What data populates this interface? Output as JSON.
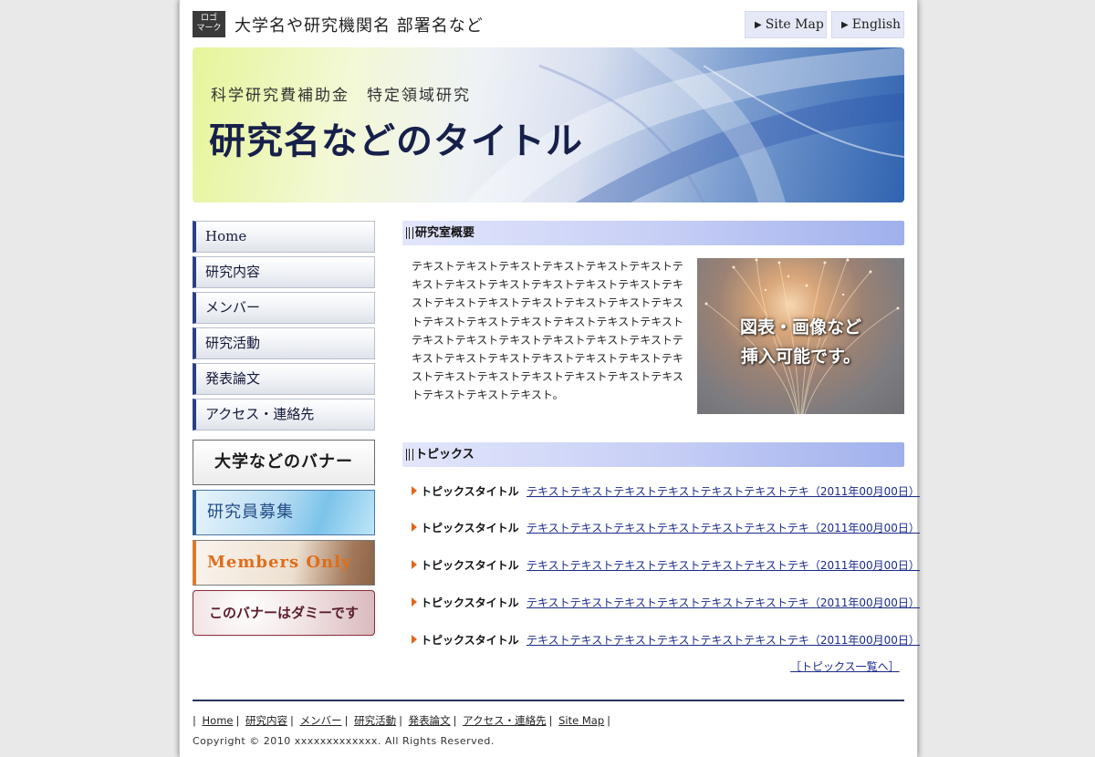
{
  "header": {
    "logo_line1": "ロゴ",
    "logo_line2": "マーク",
    "org_name": "大学名や研究機関名 部署名など",
    "sitemap_label": "Site Map",
    "english_label": "English"
  },
  "hero": {
    "subtitle": "科学研究費補助金　特定領域研究",
    "title": "研究名などのタイトル"
  },
  "nav": {
    "items": [
      {
        "label": "Home"
      },
      {
        "label": "研究内容"
      },
      {
        "label": "メンバー"
      },
      {
        "label": "研究活動"
      },
      {
        "label": "発表論文"
      },
      {
        "label": "アクセス・連絡先"
      }
    ]
  },
  "banners": {
    "univ": "大学などのバナー",
    "recruit": "研究員募集",
    "members": "Members Only",
    "dummy": "このバナーはダミーです"
  },
  "overview": {
    "heading": "研究室概要",
    "text": "テキストテキストテキストテキストテキストテキストテキストテキストテキストテキストテキストテキストテキストテキストテキストテキストテキストテキストテキストテキストテキストテキストテキストテキストテキストテキストテキストテキストテキストテキストテキストテキストテキストテキストテキストテキストテキストテキストテキストテキストテキストテキストテキストテキストテキストテキストテキスト。",
    "image_line1": "図表・画像など",
    "image_line2": "挿入可能です。"
  },
  "topics": {
    "heading": "トピックス",
    "items": [
      {
        "title": "トピックスタイトル",
        "text": "テキストテキストテキストテキストテキストテキストテキ（2011年00月00日）"
      },
      {
        "title": "トピックスタイトル",
        "text": "テキストテキストテキストテキストテキストテキストテキ（2011年00月00日）"
      },
      {
        "title": "トピックスタイトル",
        "text": "テキストテキストテキストテキストテキストテキストテキ（2011年00月00日）"
      },
      {
        "title": "トピックスタイトル",
        "text": "テキストテキストテキストテキストテキストテキストテキ（2011年00月00日）"
      },
      {
        "title": "トピックスタイトル",
        "text": "テキストテキストテキストテキストテキストテキストテキ（2011年00月00日）"
      }
    ],
    "more_label": "［トピックス一覧へ］"
  },
  "footer": {
    "links": [
      "Home",
      "研究内容",
      "メンバー",
      "研究活動",
      "発表論文",
      "アクセス・連絡先",
      "Site Map"
    ],
    "copyright": "Copyright © 2010 xxxxxxxxxxxxx. All Rights Reserved."
  },
  "colors": {
    "nav_accent": "#2b3f85",
    "section_head": "#c5cdf5",
    "link": "#1b2a8a",
    "topic_arrow": "#e2661a",
    "footer_rule": "#25335e"
  }
}
